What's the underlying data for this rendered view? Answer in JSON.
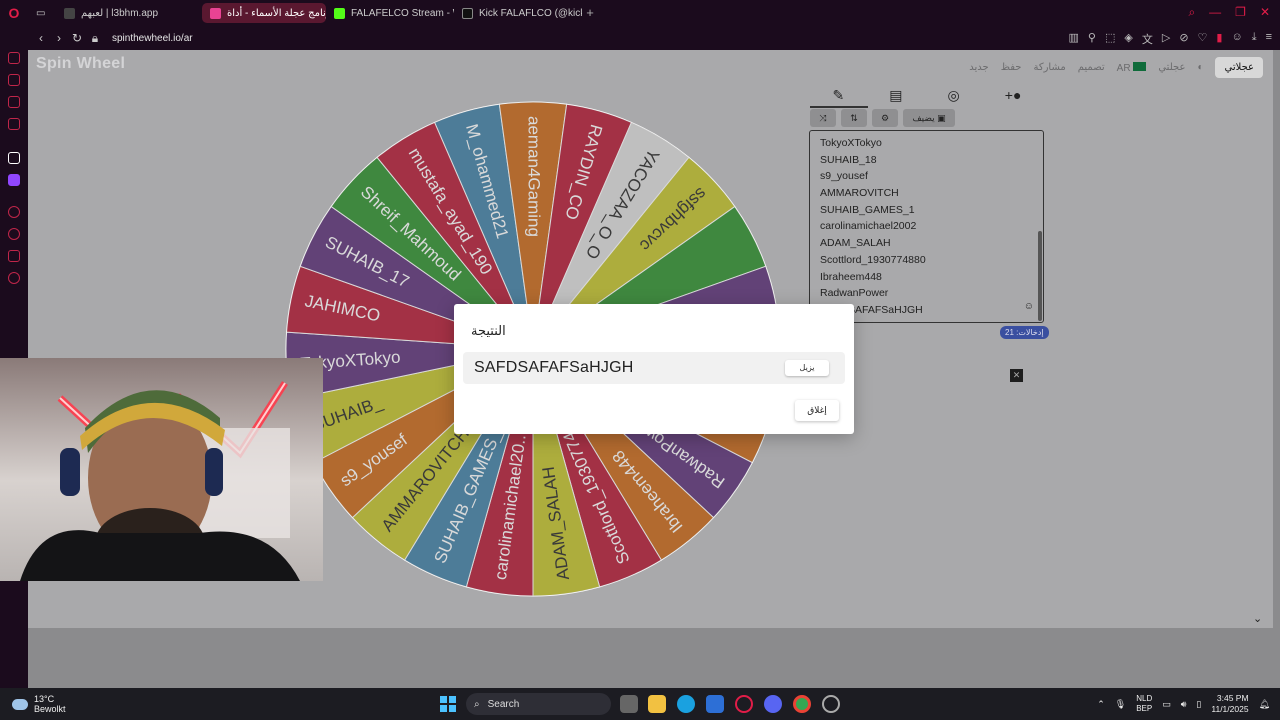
{
  "browser": {
    "tabs": [
      {
        "label": "لعبهم | l3bhm.app",
        "active": false
      },
      {
        "label": "برنامج عجلة الأسماء - أداة ...",
        "active": true
      },
      {
        "label": "FALAFELCO Stream - Wat",
        "active": false
      },
      {
        "label": "Kick FALAFLCO (@kick_fa",
        "active": false
      }
    ],
    "url": "spinthewheel.io/ar"
  },
  "site": {
    "logo": "Spin Wheel",
    "menu": [
      "جديد",
      "حفظ",
      "مشاركة",
      "تصميم",
      "عجلتي",
      "AR"
    ],
    "lang_button": "عجلاتي",
    "add_image_label": "يضيف"
  },
  "entries": [
    "TokyoXTokyo",
    "SUHAIB_18",
    "s9_yousef",
    "AMMAROVITCH",
    "SUHAIB_GAMES_1",
    "carolinamichael2002",
    "ADAM_SALAH",
    "Scottlord_1930774880",
    "Ibraheem448",
    "RadwanPower",
    "SAFDSAFAFSaHJGH"
  ],
  "entries_count": "إدخالات: 21",
  "wheel_segments": [
    {
      "label": "M_ohammed21",
      "color": "#3d7ea6"
    },
    {
      "label": "aeman4Gaming",
      "color": "#c96614"
    },
    {
      "label": "RAYDIN_CO",
      "color": "#b51733"
    },
    {
      "label": "YACOZAA_O_O",
      "color": "#dcdcdc"
    },
    {
      "label": "ssfghbvcvc",
      "color": "#c2c228"
    },
    {
      "label": "",
      "color": "#2a8f2a"
    },
    {
      "label": "",
      "color": "#5a2f78"
    },
    {
      "label": "",
      "color": "#3d7ea6"
    },
    {
      "label": "",
      "color": "#c96614"
    },
    {
      "label": "RadwanPower",
      "color": "#5a2f78"
    },
    {
      "label": "Ibraheem448",
      "color": "#c96614"
    },
    {
      "label": "Scottlord_1930774...",
      "color": "#b51733"
    },
    {
      "label": "ADAM_SALAH",
      "color": "#c2c228"
    },
    {
      "label": "carolinamichael20...",
      "color": "#b51733"
    },
    {
      "label": "SUHAIB_GAMES_1",
      "color": "#3d7ea6"
    },
    {
      "label": "AMMAROVITCH",
      "color": "#c2c228"
    },
    {
      "label": "s9_yousef",
      "color": "#c96614"
    },
    {
      "label": "SUHAIB_",
      "color": "#c2c228"
    },
    {
      "label": "TokyoXTokyo",
      "color": "#5a2f78"
    },
    {
      "label": "JAHIMCO",
      "color": "#b51733"
    },
    {
      "label": "SUHAIB_17",
      "color": "#5a2f78"
    },
    {
      "label": "Shreif_Mahmoud",
      "color": "#2a8f2a"
    },
    {
      "label": "mustafa_ayad_190",
      "color": "#b51733"
    }
  ],
  "modal": {
    "title": "النتيجة",
    "result": "SAFDSAFAFSaHJGH",
    "remove_label": "يزيل",
    "close_label": "إغلاق"
  },
  "taskbar": {
    "weather_temp": "13°C",
    "weather_desc": "Bewolkt",
    "search_placeholder": "Search",
    "lang1": "NLD",
    "lang2": "BEP",
    "time": "3:45 PM",
    "date": "11/1/2025"
  }
}
